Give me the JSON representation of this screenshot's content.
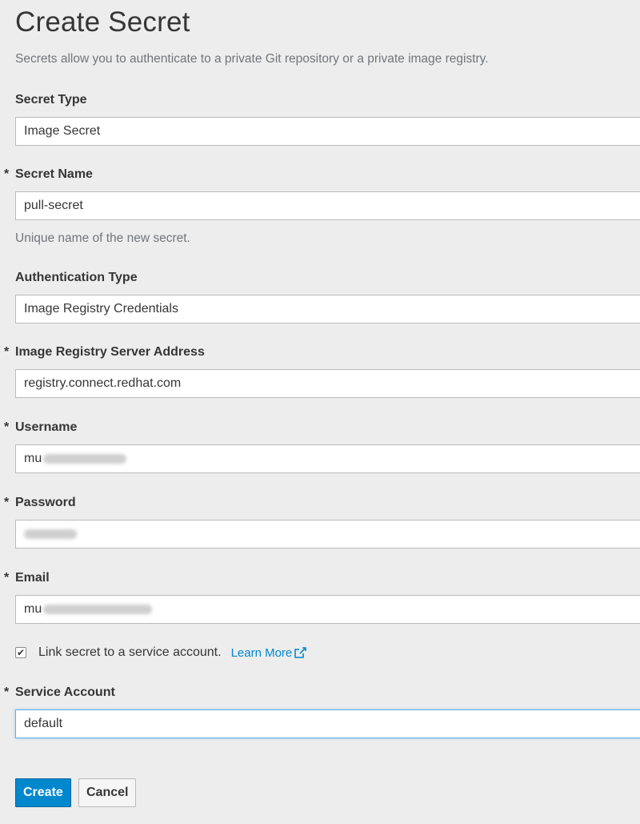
{
  "page": {
    "title": "Create Secret",
    "intro": "Secrets allow you to authenticate to a private Git repository or a private image registry."
  },
  "form": {
    "required_marker": "*",
    "secret_type": {
      "label": "Secret Type",
      "value": "Image Secret"
    },
    "secret_name": {
      "label": "Secret Name",
      "value": "pull-secret",
      "help": "Unique name of the new secret."
    },
    "auth_type": {
      "label": "Authentication Type",
      "value": "Image Registry Credentials"
    },
    "registry": {
      "label": "Image Registry Server Address",
      "value": "registry.connect.redhat.com"
    },
    "username": {
      "label": "Username",
      "value_visible": "mu"
    },
    "password": {
      "label": "Password"
    },
    "email": {
      "label": "Email",
      "value_visible": "mu"
    },
    "link_checkbox": {
      "label": "Link secret to a service account.",
      "checked": true,
      "learn_more": "Learn More"
    },
    "service_account": {
      "label": "Service Account",
      "value": "default"
    }
  },
  "actions": {
    "create": "Create",
    "cancel": "Cancel"
  },
  "colors": {
    "primary": "#0088ce",
    "background": "#ededed",
    "focus": "#66afe9"
  }
}
